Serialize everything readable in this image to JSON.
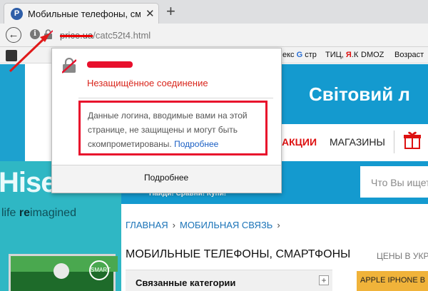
{
  "browser": {
    "tab": {
      "favicon_letter": "P",
      "title": "Мобильные телефоны, см",
      "close_glyph": "✕"
    },
    "new_tab_glyph": "+",
    "address": {
      "host": "price.ua",
      "path": "/catc52t4.html"
    },
    "bookmarks": [
      {
        "label": "екс "
      },
      {
        "label": "G",
        "accent": true
      },
      {
        "label": " стр"
      },
      {
        "label": "ТИЦ, "
      },
      {
        "label": "Я",
        "accent": true
      },
      {
        "label": ".К"
      },
      {
        "label": "DMOZ"
      },
      {
        "label": "Возраст"
      }
    ]
  },
  "popup": {
    "status": "Незащищённое соединение",
    "warning": "Данные логина, вводимые вами на этой странице, не защищены и могут быть скомпрометированы.",
    "warning_link": "Подробнее",
    "footer_button": "Подробнее"
  },
  "page": {
    "header_title": "Світовий л",
    "nav": {
      "sales": "АКЦИИ",
      "shops": "МАГАЗИНЫ"
    },
    "search_placeholder": "Что Вы ищете",
    "slogan": "Найди! Сравни! Купи!",
    "promo": {
      "brand": "Hisense",
      "tagline_a": "life ",
      "tagline_b": "re",
      "tagline_c": "imagined",
      "badge": "SMART"
    },
    "breadcrumb": [
      "ГЛАВНАЯ",
      "МОБИЛЬНАЯ СВЯЗЬ"
    ],
    "breadcrumb_sep": "›",
    "title": "МОБИЛЬНЫЕ ТЕЛЕФОНЫ, СМАРТФОНЫ",
    "subtitle": "ЦЕНЫ В УКРА",
    "related_title": "Связанные категории",
    "related_plus": "+",
    "apple_card": "APPLE IPHONE В"
  },
  "colors": {
    "accent_blue": "#149acf",
    "warning_red": "#e8102c",
    "link_blue": "#1a5fc4"
  }
}
